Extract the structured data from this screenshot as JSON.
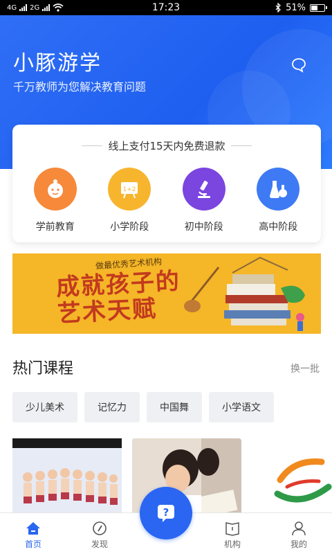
{
  "status_bar": {
    "network_1": "4G",
    "network_2": "2G",
    "time": "17:23",
    "battery_text": "51%",
    "battery_level": 0.51
  },
  "header": {
    "title": "小豚游学",
    "subtitle": "千万教师为您解决教育问题",
    "message_icon": "chat-bubble-icon"
  },
  "card": {
    "refund_text": "线上支付15天内免费退款",
    "categories": [
      {
        "label": "学前教育",
        "icon": "baby-face-icon",
        "color": "#f6893a"
      },
      {
        "label": "小学阶段",
        "icon": "chalkboard-icon",
        "color": "#f7b52e"
      },
      {
        "label": "初中阶段",
        "icon": "microscope-icon",
        "color": "#7b45e0"
      },
      {
        "label": "高中阶段",
        "icon": "flask-icon",
        "color": "#3f7af5"
      }
    ]
  },
  "banner": {
    "main_text": "成就孩子的艺术天赋",
    "small_text": "做最优秀艺术机构"
  },
  "hot": {
    "title": "热门课程",
    "more": "换一批",
    "tags": [
      "少儿美术",
      "记忆力",
      "中国舞",
      "小学语文"
    ]
  },
  "nav": {
    "items": [
      {
        "label": "首页",
        "icon": "home-icon",
        "active": true
      },
      {
        "label": "发现",
        "icon": "compass-icon",
        "active": false
      },
      {
        "label": "",
        "icon": "question-icon",
        "active": false
      },
      {
        "label": "机构",
        "icon": "book-icon",
        "active": false
      },
      {
        "label": "我的",
        "icon": "user-icon",
        "active": false
      }
    ]
  },
  "colors": {
    "primary": "#2a66f2",
    "banner_bg": "#f5b627"
  }
}
